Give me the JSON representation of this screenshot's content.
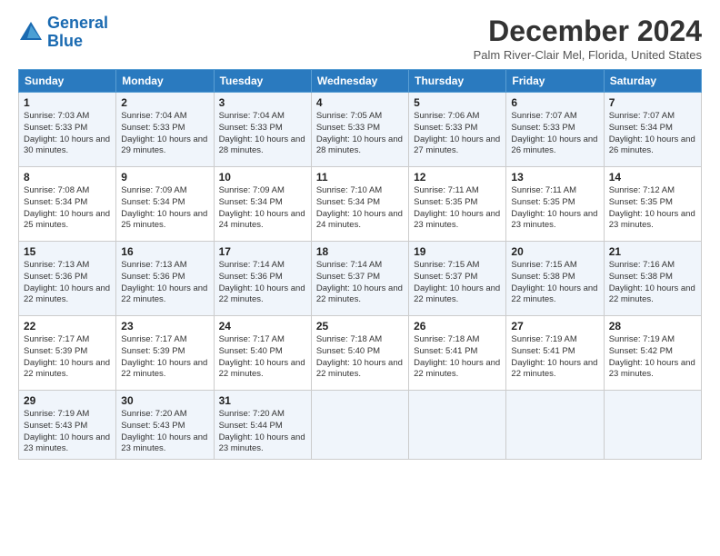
{
  "header": {
    "logo_line1": "General",
    "logo_line2": "Blue",
    "month_title": "December 2024",
    "location": "Palm River-Clair Mel, Florida, United States"
  },
  "weekdays": [
    "Sunday",
    "Monday",
    "Tuesday",
    "Wednesday",
    "Thursday",
    "Friday",
    "Saturday"
  ],
  "weeks": [
    [
      {
        "day": "1",
        "rise": "Sunrise: 7:03 AM",
        "set": "Sunset: 5:33 PM",
        "daylight": "Daylight: 10 hours and 30 minutes."
      },
      {
        "day": "2",
        "rise": "Sunrise: 7:04 AM",
        "set": "Sunset: 5:33 PM",
        "daylight": "Daylight: 10 hours and 29 minutes."
      },
      {
        "day": "3",
        "rise": "Sunrise: 7:04 AM",
        "set": "Sunset: 5:33 PM",
        "daylight": "Daylight: 10 hours and 28 minutes."
      },
      {
        "day": "4",
        "rise": "Sunrise: 7:05 AM",
        "set": "Sunset: 5:33 PM",
        "daylight": "Daylight: 10 hours and 28 minutes."
      },
      {
        "day": "5",
        "rise": "Sunrise: 7:06 AM",
        "set": "Sunset: 5:33 PM",
        "daylight": "Daylight: 10 hours and 27 minutes."
      },
      {
        "day": "6",
        "rise": "Sunrise: 7:07 AM",
        "set": "Sunset: 5:33 PM",
        "daylight": "Daylight: 10 hours and 26 minutes."
      },
      {
        "day": "7",
        "rise": "Sunrise: 7:07 AM",
        "set": "Sunset: 5:34 PM",
        "daylight": "Daylight: 10 hours and 26 minutes."
      }
    ],
    [
      {
        "day": "8",
        "rise": "Sunrise: 7:08 AM",
        "set": "Sunset: 5:34 PM",
        "daylight": "Daylight: 10 hours and 25 minutes."
      },
      {
        "day": "9",
        "rise": "Sunrise: 7:09 AM",
        "set": "Sunset: 5:34 PM",
        "daylight": "Daylight: 10 hours and 25 minutes."
      },
      {
        "day": "10",
        "rise": "Sunrise: 7:09 AM",
        "set": "Sunset: 5:34 PM",
        "daylight": "Daylight: 10 hours and 24 minutes."
      },
      {
        "day": "11",
        "rise": "Sunrise: 7:10 AM",
        "set": "Sunset: 5:34 PM",
        "daylight": "Daylight: 10 hours and 24 minutes."
      },
      {
        "day": "12",
        "rise": "Sunrise: 7:11 AM",
        "set": "Sunset: 5:35 PM",
        "daylight": "Daylight: 10 hours and 23 minutes."
      },
      {
        "day": "13",
        "rise": "Sunrise: 7:11 AM",
        "set": "Sunset: 5:35 PM",
        "daylight": "Daylight: 10 hours and 23 minutes."
      },
      {
        "day": "14",
        "rise": "Sunrise: 7:12 AM",
        "set": "Sunset: 5:35 PM",
        "daylight": "Daylight: 10 hours and 23 minutes."
      }
    ],
    [
      {
        "day": "15",
        "rise": "Sunrise: 7:13 AM",
        "set": "Sunset: 5:36 PM",
        "daylight": "Daylight: 10 hours and 22 minutes."
      },
      {
        "day": "16",
        "rise": "Sunrise: 7:13 AM",
        "set": "Sunset: 5:36 PM",
        "daylight": "Daylight: 10 hours and 22 minutes."
      },
      {
        "day": "17",
        "rise": "Sunrise: 7:14 AM",
        "set": "Sunset: 5:36 PM",
        "daylight": "Daylight: 10 hours and 22 minutes."
      },
      {
        "day": "18",
        "rise": "Sunrise: 7:14 AM",
        "set": "Sunset: 5:37 PM",
        "daylight": "Daylight: 10 hours and 22 minutes."
      },
      {
        "day": "19",
        "rise": "Sunrise: 7:15 AM",
        "set": "Sunset: 5:37 PM",
        "daylight": "Daylight: 10 hours and 22 minutes."
      },
      {
        "day": "20",
        "rise": "Sunrise: 7:15 AM",
        "set": "Sunset: 5:38 PM",
        "daylight": "Daylight: 10 hours and 22 minutes."
      },
      {
        "day": "21",
        "rise": "Sunrise: 7:16 AM",
        "set": "Sunset: 5:38 PM",
        "daylight": "Daylight: 10 hours and 22 minutes."
      }
    ],
    [
      {
        "day": "22",
        "rise": "Sunrise: 7:17 AM",
        "set": "Sunset: 5:39 PM",
        "daylight": "Daylight: 10 hours and 22 minutes."
      },
      {
        "day": "23",
        "rise": "Sunrise: 7:17 AM",
        "set": "Sunset: 5:39 PM",
        "daylight": "Daylight: 10 hours and 22 minutes."
      },
      {
        "day": "24",
        "rise": "Sunrise: 7:17 AM",
        "set": "Sunset: 5:40 PM",
        "daylight": "Daylight: 10 hours and 22 minutes."
      },
      {
        "day": "25",
        "rise": "Sunrise: 7:18 AM",
        "set": "Sunset: 5:40 PM",
        "daylight": "Daylight: 10 hours and 22 minutes."
      },
      {
        "day": "26",
        "rise": "Sunrise: 7:18 AM",
        "set": "Sunset: 5:41 PM",
        "daylight": "Daylight: 10 hours and 22 minutes."
      },
      {
        "day": "27",
        "rise": "Sunrise: 7:19 AM",
        "set": "Sunset: 5:41 PM",
        "daylight": "Daylight: 10 hours and 22 minutes."
      },
      {
        "day": "28",
        "rise": "Sunrise: 7:19 AM",
        "set": "Sunset: 5:42 PM",
        "daylight": "Daylight: 10 hours and 23 minutes."
      }
    ],
    [
      {
        "day": "29",
        "rise": "Sunrise: 7:19 AM",
        "set": "Sunset: 5:43 PM",
        "daylight": "Daylight: 10 hours and 23 minutes."
      },
      {
        "day": "30",
        "rise": "Sunrise: 7:20 AM",
        "set": "Sunset: 5:43 PM",
        "daylight": "Daylight: 10 hours and 23 minutes."
      },
      {
        "day": "31",
        "rise": "Sunrise: 7:20 AM",
        "set": "Sunset: 5:44 PM",
        "daylight": "Daylight: 10 hours and 23 minutes."
      },
      {
        "day": "",
        "rise": "",
        "set": "",
        "daylight": ""
      },
      {
        "day": "",
        "rise": "",
        "set": "",
        "daylight": ""
      },
      {
        "day": "",
        "rise": "",
        "set": "",
        "daylight": ""
      },
      {
        "day": "",
        "rise": "",
        "set": "",
        "daylight": ""
      }
    ]
  ]
}
